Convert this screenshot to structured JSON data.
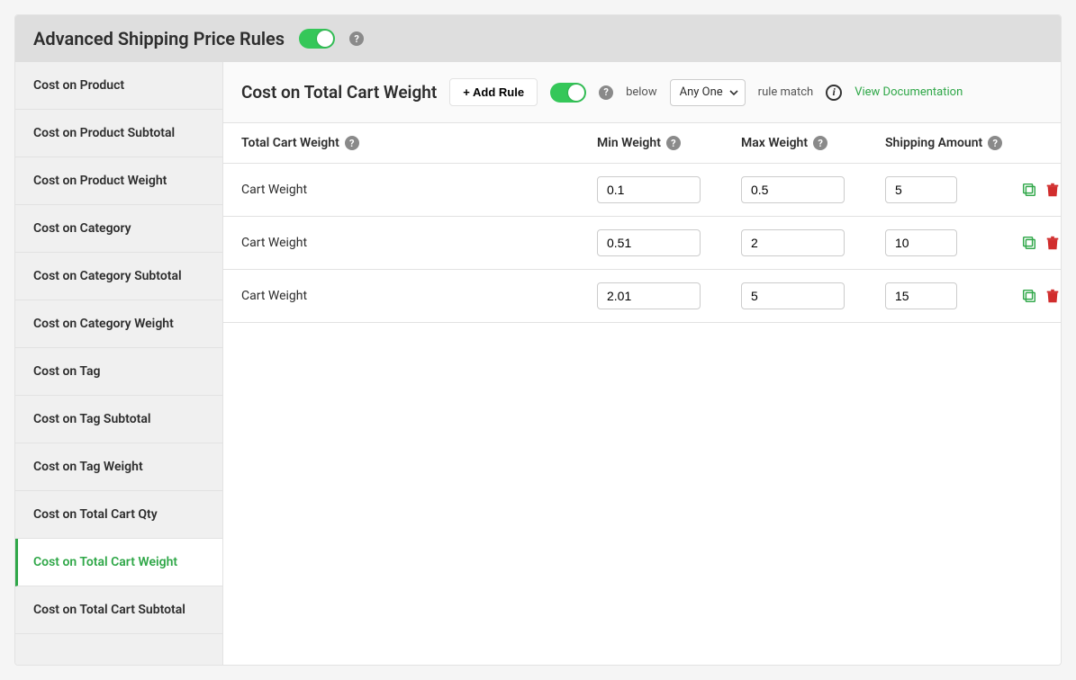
{
  "header": {
    "title": "Advanced Shipping Price Rules"
  },
  "sidebar": {
    "items": [
      {
        "label": "Cost on Product",
        "active": false
      },
      {
        "label": "Cost on Product Subtotal",
        "active": false
      },
      {
        "label": "Cost on Product Weight",
        "active": false
      },
      {
        "label": "Cost on Category",
        "active": false
      },
      {
        "label": "Cost on Category Subtotal",
        "active": false
      },
      {
        "label": "Cost on Category Weight",
        "active": false
      },
      {
        "label": "Cost on Tag",
        "active": false
      },
      {
        "label": "Cost on Tag Subtotal",
        "active": false
      },
      {
        "label": "Cost on Tag Weight",
        "active": false
      },
      {
        "label": "Cost on Total Cart Qty",
        "active": false
      },
      {
        "label": "Cost on Total Cart Weight",
        "active": true
      },
      {
        "label": "Cost on Total Cart Subtotal",
        "active": false
      }
    ]
  },
  "toolbar": {
    "title": "Cost on Total Cart Weight",
    "add_rule_label": "+ Add Rule",
    "below_label": "below",
    "match_select_value": "Any One",
    "rule_match_label": "rule match",
    "doc_link_label": "View Documentation"
  },
  "columns": {
    "label": "Total Cart Weight",
    "min": "Min Weight",
    "max": "Max Weight",
    "amount": "Shipping Amount"
  },
  "rows": [
    {
      "label": "Cart Weight",
      "min": "0.1",
      "max": "0.5",
      "amount": "5"
    },
    {
      "label": "Cart Weight",
      "min": "0.51",
      "max": "2",
      "amount": "10"
    },
    {
      "label": "Cart Weight",
      "min": "2.01",
      "max": "5",
      "amount": "15"
    }
  ],
  "colors": {
    "accent_green": "#2fa748",
    "toggle_green": "#35c759",
    "trash_red": "#d12d2d"
  }
}
